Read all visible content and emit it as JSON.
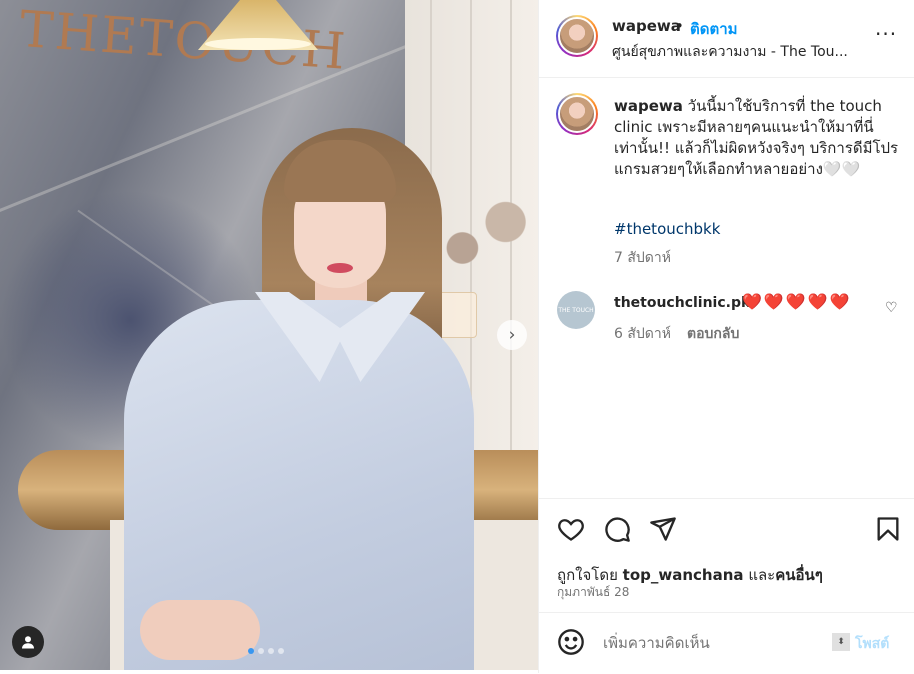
{
  "photo": {
    "brand_text": "THETOUCH",
    "next_glyph": "›",
    "carousel_count": 4,
    "carousel_active": 0
  },
  "header": {
    "username": "wapewa",
    "separator": "•",
    "follow_label": "ติดตาม",
    "location": "ศูนย์สุขภาพและความงาม - The Tou...",
    "more_glyph": "···"
  },
  "caption": {
    "username": "wapewa",
    "text": "วันนี้มาใช้บริการที่ the touch clinic เพราะมีหลายๆคนแนะนำให้มาที่นี่เท่านั้น!! แล้วก็ไม่ผิดหวังจริงๆ บริการดีมีโปรแกรมสวยๆให้เลือกทำหลายอย่าง🤍🤍",
    "hashtag": "#thetouchbkk",
    "time": "7 สัปดาห์"
  },
  "comment": {
    "avatar_text": "THE TOUCH",
    "username": "thetouchclinic.pk",
    "text": "❤️❤️❤️❤️❤️",
    "time": "6 สัปดาห์",
    "reply_label": "ตอบกลับ",
    "like_glyph": "♡"
  },
  "likes": {
    "prefix": "ถูกใจโดย",
    "user": "top_wanchana",
    "middle": "และ",
    "others": "คนอื่นๆ"
  },
  "date": "กุมภาพันธ์ 28",
  "add_comment": {
    "placeholder": "เพิ่มความคิดเห็น",
    "post_label": "โพสต์"
  },
  "colors": {
    "accent": "#0095f6",
    "hashtag": "#00376b",
    "secondary_text": "#737373",
    "heart": "#e0245e",
    "post_disabled": "#b2dffc"
  }
}
